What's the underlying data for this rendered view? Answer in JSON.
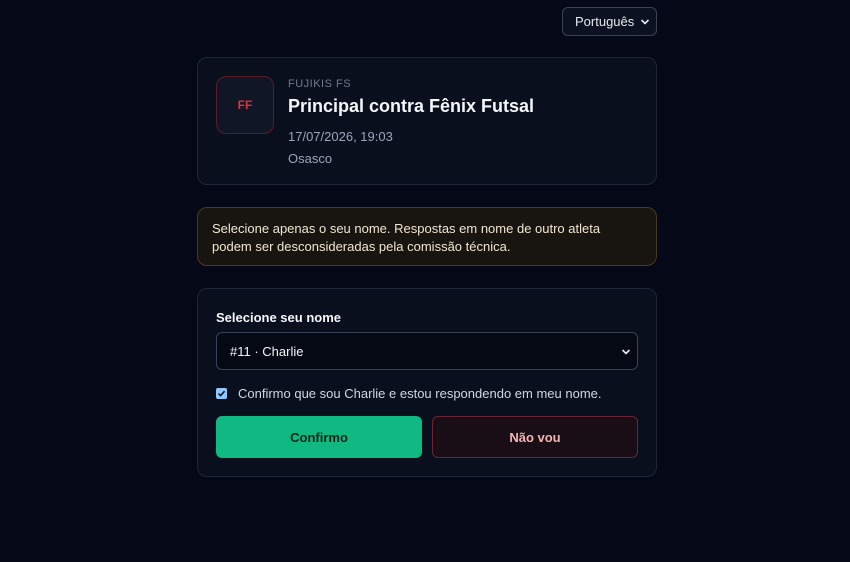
{
  "language": {
    "selected": "Português"
  },
  "event": {
    "logo_initials": "FF",
    "team": "FUJIKIS FS",
    "title": "Principal contra Fênix Futsal",
    "datetime": "17/07/2026, 19:03",
    "location": "Osasco"
  },
  "notice": {
    "text": "Selecione apenas o seu nome. Respostas em nome de outro atleta podem ser desconsideradas pela comissão técnica."
  },
  "form": {
    "label": "Selecione seu nome",
    "selected_player": "#11 · Charlie",
    "confirm_checked": true,
    "confirm_text": "Confirmo que sou Charlie e estou respondendo em meu nome.",
    "yes_label": "Confirmo",
    "no_label": "Não vou"
  },
  "colors": {
    "background": "#050816",
    "accent_green": "#10b981",
    "danger_red": "#e0303a"
  },
  "icons": [
    "chevron-down-icon",
    "check-icon"
  ]
}
